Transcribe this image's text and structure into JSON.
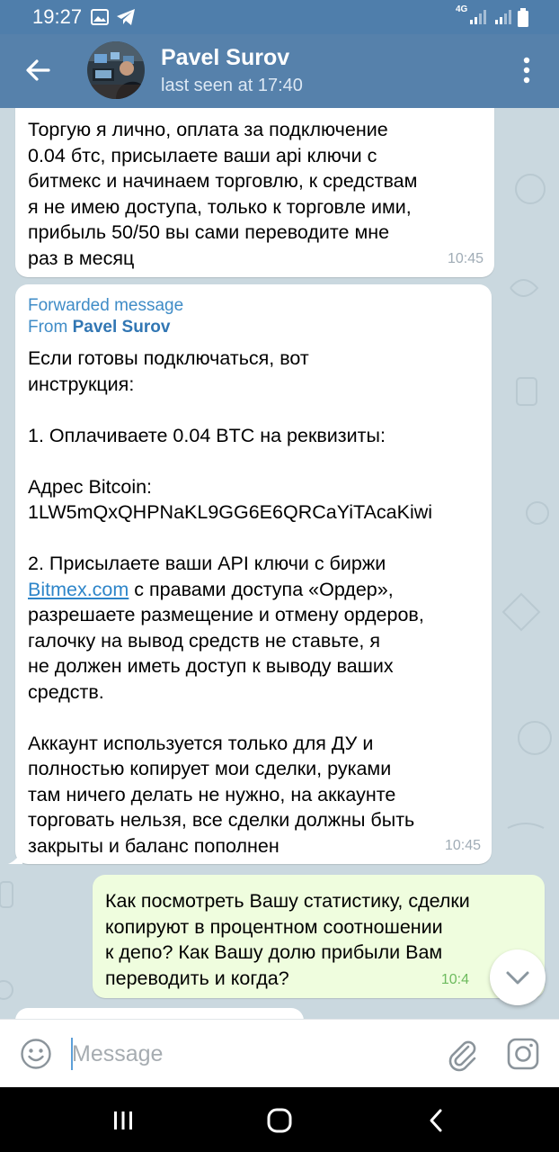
{
  "status_bar": {
    "time": "19:27",
    "network": "4G",
    "icons": [
      "gallery-icon",
      "telegram-icon",
      "signal-icon",
      "signal-icon",
      "battery-icon"
    ]
  },
  "header": {
    "name": "Pavel Surov",
    "status": "last seen at 17:40",
    "icons": [
      "back-arrow-icon",
      "more-vertical-icon"
    ]
  },
  "messages": [
    {
      "direction": "incoming",
      "text": "Торгую я лично, оплата за подключение\n0.04 бтс, присылаете ваши api ключи с\nбитмекс и начинаем торговлю, к средствам\nя не имею доступа, только к торговле ими,\nприбыль 50/50 вы сами переводите мне\nраз в месяц",
      "time": "10:45"
    },
    {
      "direction": "incoming",
      "forwarded_label": "Forwarded message",
      "forwarded_from_prefix": "From",
      "forwarded_from": "Pavel Surov",
      "text_part1": "Если готовы подключаться, вот\nинструкция:\n\n1. Оплачиваете 0.04 BTC на реквизиты:\n\nАдрес Bitcoin:\n1LW5mQxQHPNaKL9GG6E6QRCaYiTAcaKiwi\n\n2. Присылаете ваши API ключи с биржи\n",
      "link": "Bitmex.com",
      "text_part2": " с правами доступа «Ордер»,\nразрешаете размещение и отмену ордеров,\nгалочку на вывод средств не ставьте, я\nне должен иметь доступ к выводу ваших\nсредств.\n\nАккаунт используется только для ДУ и\nполностью копирует мои сделки, руками\nтам ничего делать не нужно, на аккаунте\nторговать нельзя, все сделки должны быть\nзакрыты и баланс пополнен",
      "time": "10:45"
    },
    {
      "direction": "outgoing",
      "text": "Как посмотреть Вашу статистику, сделки\nкопируют в процентном соотношении\nк депо? Как Вашу долю прибыли Вам\nпереводить и когда?",
      "time": "10:4"
    }
  ],
  "scroll_button": {
    "icon": "chevron-down-icon"
  },
  "input": {
    "placeholder": "Message",
    "icons": [
      "emoji-icon",
      "paperclip-icon",
      "camera-icon"
    ]
  },
  "nav_bar": {
    "icons": [
      "recent-apps-icon",
      "home-icon",
      "back-icon"
    ]
  },
  "colors": {
    "header": "#5681ab",
    "status_bar": "#4f7eab",
    "chat_background": "#cad8df",
    "incoming_bubble": "#ffffff",
    "outgoing_bubble": "#effdde",
    "link": "#2d85c9",
    "forward_label": "#3f8cc7"
  }
}
